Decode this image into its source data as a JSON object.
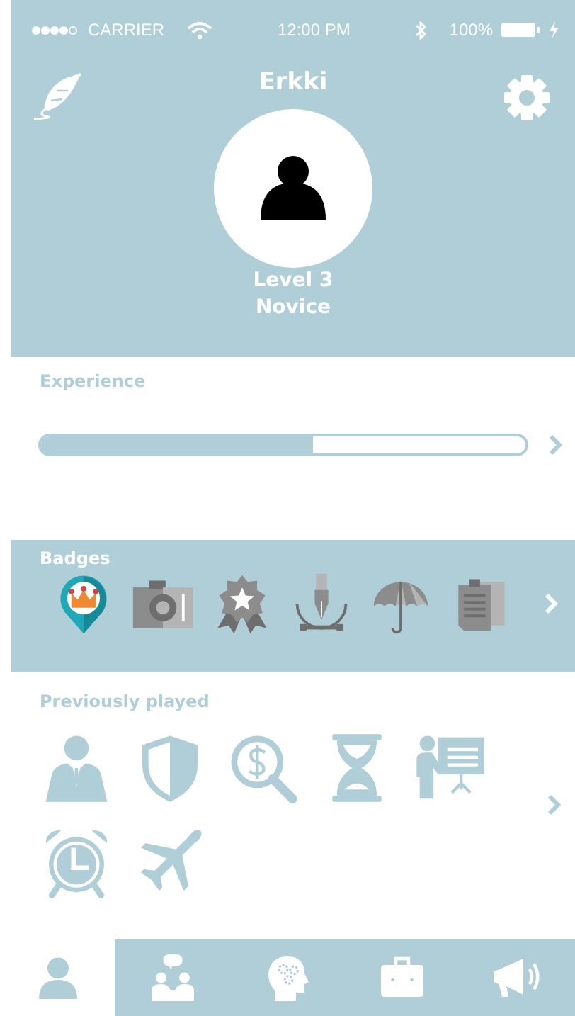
{
  "status_bar": {
    "carrier": "CARRIER",
    "time": "12:00 PM",
    "battery": "100%"
  },
  "profile": {
    "name": "Erkki",
    "level": "Level 3",
    "rank": "Novice"
  },
  "experience": {
    "label": "Experience",
    "level": 0.56
  },
  "badges": {
    "label": "Badges",
    "items": [
      {
        "kind": "crown-pin",
        "earned": true
      },
      {
        "kind": "camera",
        "earned": false
      },
      {
        "kind": "award",
        "earned": false
      },
      {
        "kind": "pen",
        "earned": false
      },
      {
        "kind": "umbrella",
        "earned": false
      },
      {
        "kind": "clipboard",
        "earned": false
      }
    ]
  },
  "previously_played": {
    "label": "Previously played",
    "items": [
      {
        "kind": "businessman"
      },
      {
        "kind": "shield"
      },
      {
        "kind": "money-search"
      },
      {
        "kind": "hourglass"
      },
      {
        "kind": "presenter"
      },
      {
        "kind": "alarm-clock"
      },
      {
        "kind": "airplane"
      }
    ]
  },
  "tab_bar": [
    {
      "kind": "person",
      "selected": true
    },
    {
      "kind": "chat-people",
      "selected": false
    },
    {
      "kind": "head-gears",
      "selected": false
    },
    {
      "kind": "briefcase",
      "selected": false
    },
    {
      "kind": "megaphone",
      "selected": false
    }
  ]
}
